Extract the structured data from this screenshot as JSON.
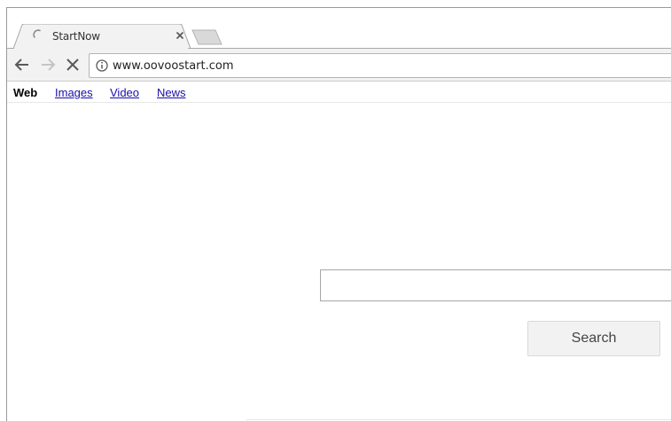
{
  "browser": {
    "tab": {
      "title": "StartNow",
      "loading": true
    },
    "toolbar": {
      "url": "www.oovoostart.com"
    }
  },
  "page": {
    "nav": {
      "web": "Web",
      "images": "Images",
      "video": "Video",
      "news": "News"
    },
    "search": {
      "value": "",
      "button_label": "Search"
    }
  }
}
